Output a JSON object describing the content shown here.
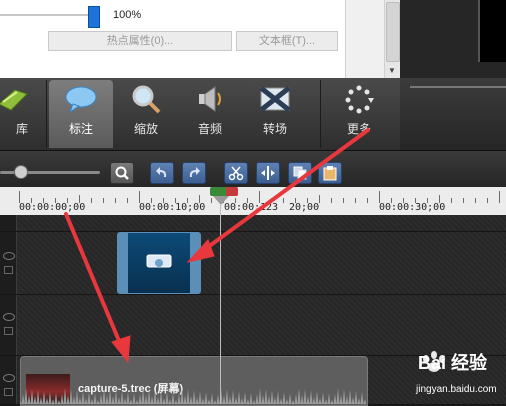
{
  "properties": {
    "slider_value": "100%",
    "hotspot_button": "热点属性(0)...",
    "textbox_button": "文本框(T)..."
  },
  "tabs": [
    {
      "label": "库",
      "icon": "library-icon",
      "active": false
    },
    {
      "label": "标注",
      "icon": "callout-icon",
      "active": true
    },
    {
      "label": "缩放",
      "icon": "zoom-magnifier-icon",
      "active": false
    },
    {
      "label": "音频",
      "icon": "speaker-icon",
      "active": false
    },
    {
      "label": "转场",
      "icon": "transition-icon",
      "active": false
    },
    {
      "label": "更多",
      "icon": "more-dots-icon",
      "active": false
    }
  ],
  "ruler": {
    "labels": [
      "00:00:00;00",
      "00:00:10;00",
      "00:00:1",
      "23",
      "20;00",
      "00:00:30;00"
    ]
  },
  "timeline": {
    "video_clip_label": "capture-5.trec (屏幕)"
  },
  "watermark": {
    "brand": "Bai  经验",
    "url": "jingyan.baidu.com"
  },
  "colors": {
    "accent_blue": "#1e73d8",
    "callout_clip": "#0d4a78",
    "annotation_arrow": "#e8383d"
  }
}
